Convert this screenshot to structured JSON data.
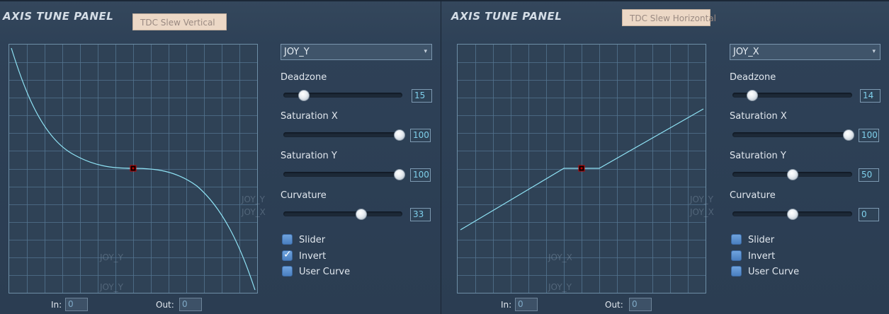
{
  "panels": [
    {
      "title": "AXIS TUNE PANEL",
      "tab_label": "TDC Slew Vertical",
      "axis": "JOY_Y",
      "ghost_labels": [
        "JOY_Y",
        "JOY_X",
        "JOY_Y",
        "JOY_Y"
      ],
      "sliders": [
        {
          "label": "Deadzone",
          "value": "15",
          "fraction": 0.15
        },
        {
          "label": "Saturation X",
          "value": "100",
          "fraction": 1.0
        },
        {
          "label": "Saturation Y",
          "value": "100",
          "fraction": 1.0
        },
        {
          "label": "Curvature",
          "value": "33",
          "fraction": 0.66
        }
      ],
      "checkboxes": [
        {
          "label": "Slider",
          "checked": false
        },
        {
          "label": "Invert",
          "checked": true
        },
        {
          "label": "User Curve",
          "checked": false
        }
      ],
      "in_label": "In:",
      "in_value": "0",
      "out_label": "Out:",
      "out_value": "0"
    },
    {
      "title": "AXIS TUNE PANEL",
      "tab_label": "TDC Slew Horizontal",
      "axis": "JOY_X",
      "ghost_labels": [
        "JOY_Y",
        "JOY_X",
        "JOY_X",
        "JOY_Y"
      ],
      "sliders": [
        {
          "label": "Deadzone",
          "value": "14",
          "fraction": 0.14
        },
        {
          "label": "Saturation X",
          "value": "100",
          "fraction": 1.0
        },
        {
          "label": "Saturation Y",
          "value": "50",
          "fraction": 0.5
        },
        {
          "label": "Curvature",
          "value": "0",
          "fraction": 0.5
        }
      ],
      "checkboxes": [
        {
          "label": "Slider",
          "checked": false
        },
        {
          "label": "Invert",
          "checked": false
        },
        {
          "label": "User Curve",
          "checked": false
        }
      ],
      "in_label": "In:",
      "in_value": "0",
      "out_label": "Out:",
      "out_value": "0"
    }
  ],
  "colors": {
    "curve": "#8fe3f5",
    "grid": "#557590",
    "center_marker": "#c00000"
  },
  "icons": {
    "dropdown_caret": "▾",
    "check": "✓"
  }
}
